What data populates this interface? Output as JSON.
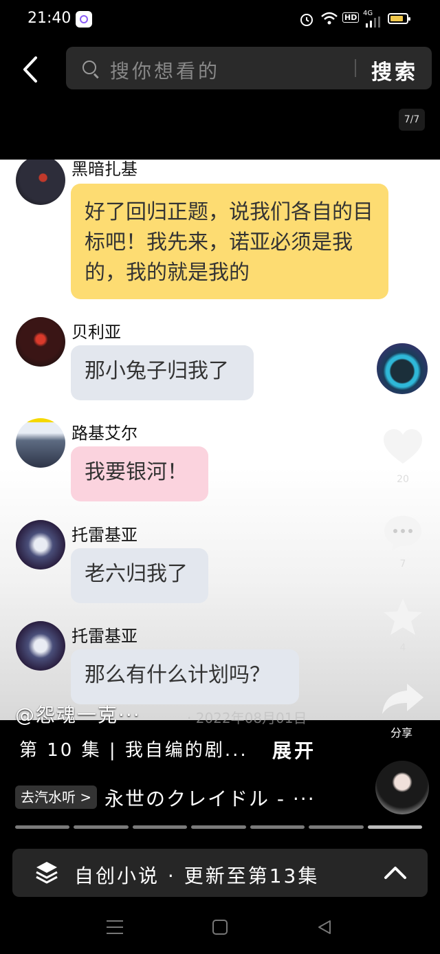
{
  "status_bar": {
    "time": "21:40",
    "hd": "HD",
    "network": "4G",
    "icons": [
      "alarm-icon",
      "wifi-icon",
      "signal-icon",
      "battery-icon"
    ]
  },
  "header": {
    "search_placeholder": "搜你想看的",
    "search_button": "搜索",
    "page_indicator": "7/7"
  },
  "chat": {
    "messages": [
      {
        "name": "黑暗扎基",
        "text": "好了回归正题，说我们各自的目标吧！我先来，诺亚必须是我的，我的就是我的",
        "bubble_color": "#fddc72"
      },
      {
        "name": "贝利亚",
        "text": "那小兔子归我了",
        "bubble_color": "#e3e7ee"
      },
      {
        "name": "路基艾尔",
        "text": "我要银河！",
        "bubble_color": "#fbd3de"
      },
      {
        "name": "托雷基亚",
        "text": "老六归我了",
        "bubble_color": "#e3e7ee"
      },
      {
        "name": "托雷基亚",
        "text": "那么有什么计划吗？",
        "bubble_color": "#e3e7ee"
      }
    ]
  },
  "side_actions": {
    "like_count": "20",
    "comment_count": "7",
    "favorite_count": "4",
    "share_label": "分享"
  },
  "video_info": {
    "author": "@怨魂一克···",
    "date": "· 2022年08月01日",
    "episode_text": "第 10 集 | 我自编的剧...",
    "expand_label": "展开",
    "music_tag": "去汽水听 >",
    "music_title": "永世のクレイドル - ···"
  },
  "collection": {
    "label": "自创小说 · 更新至第13集"
  },
  "progress": {
    "total_segments": 7,
    "current_segment": 7
  },
  "colors": {
    "accent_yellow": "#fddc72",
    "bubble_grey": "#e3e7ee",
    "bubble_pink": "#fbd3de",
    "battery": "#f2c94c"
  }
}
